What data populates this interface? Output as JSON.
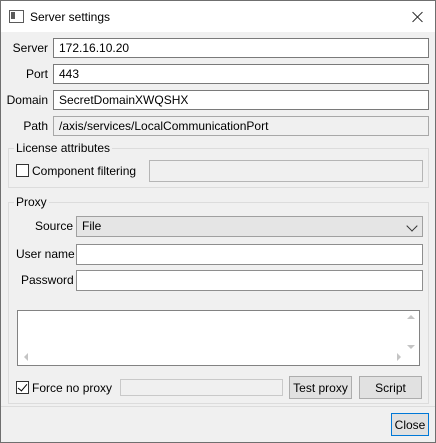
{
  "window": {
    "title": "Server settings"
  },
  "server": {
    "server_label": "Server",
    "server_value": "172.16.10.20",
    "port_label": "Port",
    "port_value": "443",
    "domain_label": "Domain",
    "domain_value": "SecretDomainXWQSHX",
    "path_label": "Path",
    "path_value": "/axis/services/LocalCommunicationPort"
  },
  "license": {
    "title": "License attributes",
    "component_filtering_label": "Component filtering",
    "component_filtering_checked": false
  },
  "proxy": {
    "title": "Proxy",
    "source_label": "Source",
    "source_value": "File",
    "username_label": "User name",
    "username_value": "",
    "password_label": "Password",
    "password_value": ""
  },
  "footer": {
    "force_no_proxy_label": "Force no proxy",
    "force_no_proxy_checked": true,
    "test_proxy_label": "Test proxy",
    "script_label": "Script",
    "close_label": "Close"
  },
  "icons": [
    "window-icon",
    "close-icon",
    "chevron-down-icon"
  ]
}
